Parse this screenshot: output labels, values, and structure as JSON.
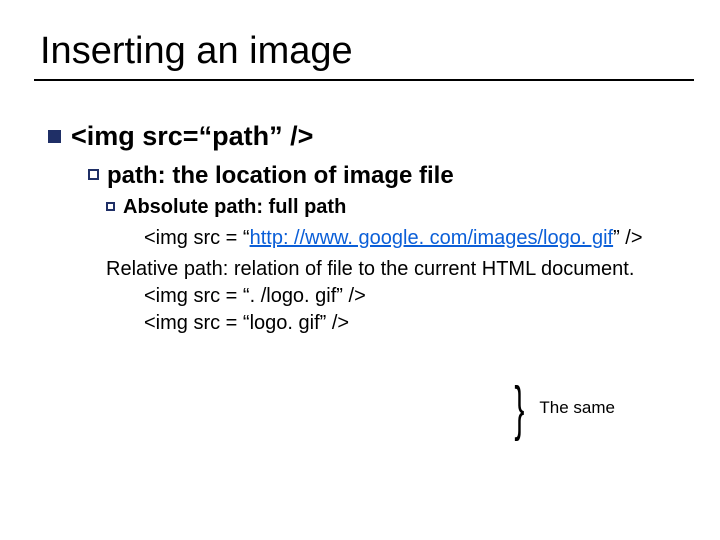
{
  "title": "Inserting an image",
  "lvl1": "<img src=“path” />",
  "lvl2": "path: the location of image file",
  "lvl3": "Absolute path: full path",
  "example_abs_pre": "<img src = “",
  "example_abs_link": "http: //www. google. com/images/logo. gif",
  "example_abs_post": "” />",
  "relative_intro": "Relative path: relation of file to the current HTML document.",
  "rel_ex1": "<img src = “. /logo. gif” />",
  "rel_ex2": "<img src = “logo. gif” />",
  "note": "The same"
}
